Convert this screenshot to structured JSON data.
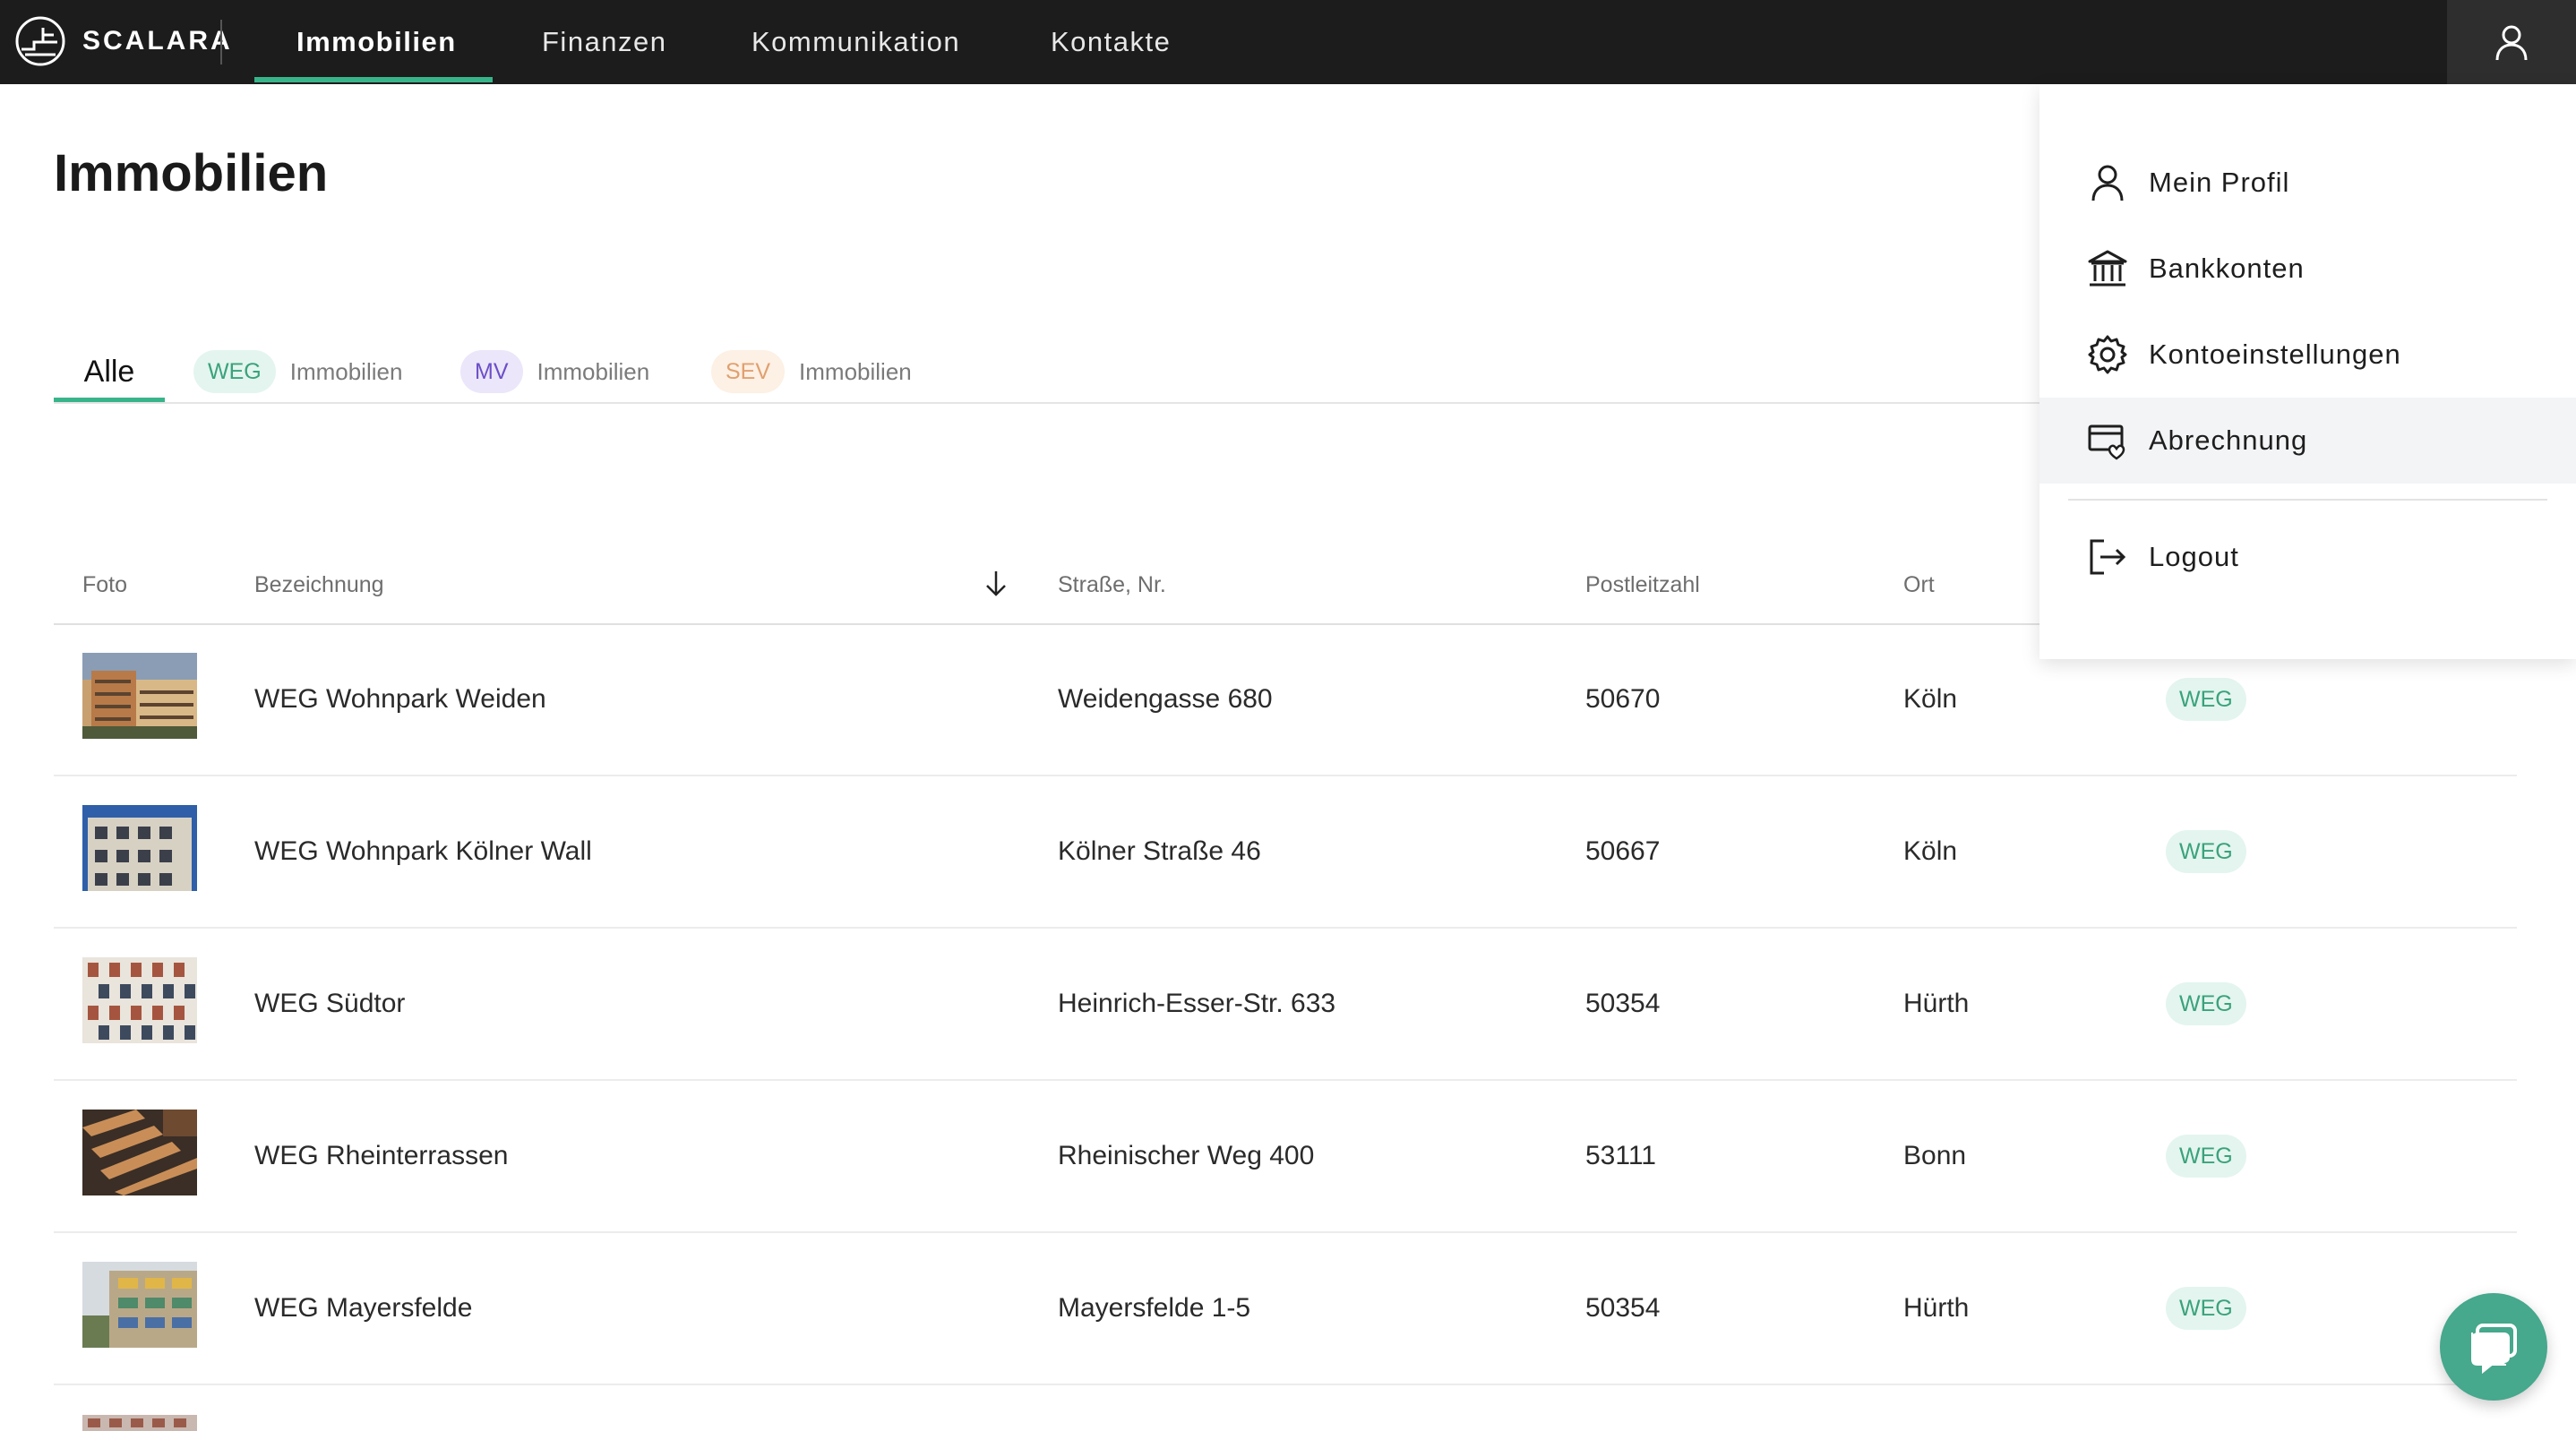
{
  "brand": {
    "name": "SCALARA"
  },
  "nav": {
    "items": [
      {
        "label": "Immobilien",
        "active": true
      },
      {
        "label": "Finanzen",
        "active": false
      },
      {
        "label": "Kommunikation",
        "active": false
      },
      {
        "label": "Kontakte",
        "active": false
      }
    ]
  },
  "page": {
    "title": "Immobilien"
  },
  "tabs": {
    "all": "Alle",
    "filters": [
      {
        "badge": "WEG",
        "label": "Immobilien"
      },
      {
        "badge": "MV",
        "label": "Immobilien"
      },
      {
        "badge": "SEV",
        "label": "Immobilien"
      }
    ]
  },
  "table": {
    "headers": {
      "foto": "Foto",
      "bezeichnung": "Bezeichnung",
      "strasse": "Straße, Nr.",
      "plz": "Postleitzahl",
      "ort": "Ort"
    },
    "rows": [
      {
        "name": "WEG Wohnpark Weiden",
        "street": "Weidengasse 680",
        "zip": "50670",
        "city": "Köln",
        "type": "WEG"
      },
      {
        "name": "WEG Wohnpark Kölner Wall",
        "street": "Kölner Straße 46",
        "zip": "50667",
        "city": "Köln",
        "type": "WEG"
      },
      {
        "name": "WEG Südtor",
        "street": "Heinrich-Esser-Str. 633",
        "zip": "50354",
        "city": "Hürth",
        "type": "WEG"
      },
      {
        "name": "WEG Rheinterrassen",
        "street": "Rheinischer Weg 400",
        "zip": "53111",
        "city": "Bonn",
        "type": "WEG"
      },
      {
        "name": "WEG Mayersfelde",
        "street": "Mayersfelde 1-5",
        "zip": "50354",
        "city": "Hürth",
        "type": "WEG"
      }
    ]
  },
  "user_menu": {
    "items": [
      {
        "label": "Mein Profil",
        "icon": "person-icon"
      },
      {
        "label": "Bankkonten",
        "icon": "bank-icon"
      },
      {
        "label": "Kontoeinstellungen",
        "icon": "gear-icon"
      },
      {
        "label": "Abrechnung",
        "icon": "billing-icon"
      }
    ],
    "logout": {
      "label": "Logout",
      "icon": "logout-icon"
    }
  },
  "colors": {
    "topbar": "#1c1c1c",
    "accent": "#38b48b",
    "weg_badge_bg": "#e3f5ee",
    "weg_badge_fg": "#3aa27c",
    "mv_badge_bg": "#ebe6fa",
    "mv_badge_fg": "#6b4fc7",
    "sev_badge_bg": "#fdf0e4",
    "sev_badge_fg": "#e0a070",
    "chat_button": "#46a88c"
  }
}
